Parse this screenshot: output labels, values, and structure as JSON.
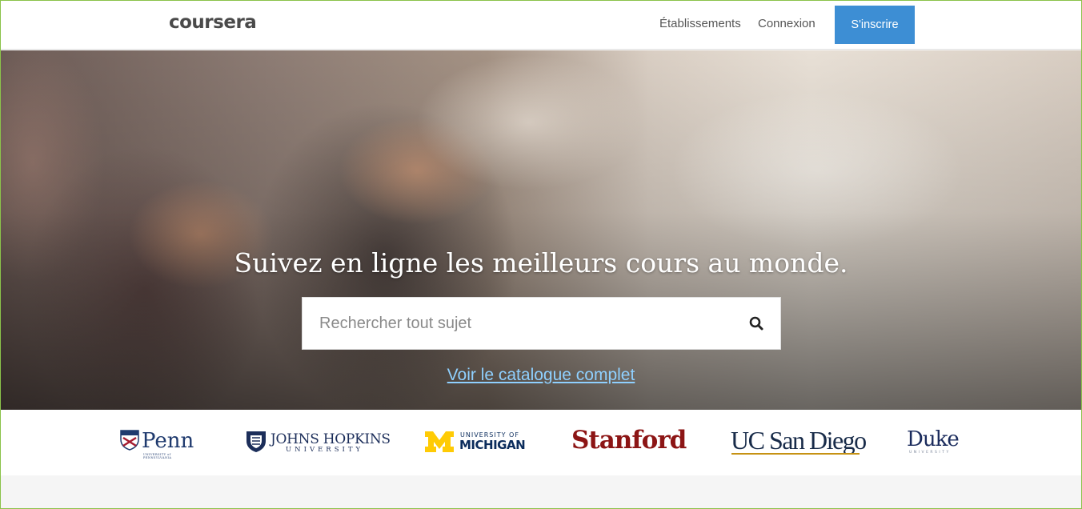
{
  "header": {
    "logo": "coursera",
    "nav": {
      "etablissements": "Établissements",
      "connexion": "Connexion"
    },
    "signup_label": "S'inscrire"
  },
  "hero": {
    "title": "Suivez en ligne les meilleurs cours au monde.",
    "search": {
      "placeholder": "Rechercher tout sujet",
      "value": ""
    },
    "search_icon": "search-icon",
    "catalog_link": "Voir le catalogue complet"
  },
  "partners": {
    "penn": {
      "name": "Penn",
      "sub": "UNIVERSITY of PENNSYLVANIA"
    },
    "jhu": {
      "name": "JOHNS HOPKINS",
      "sub": "UNIVERSITY"
    },
    "umich": {
      "sub": "UNIVERSITY OF",
      "name": "MICHIGAN"
    },
    "stanford": {
      "name": "Stanford"
    },
    "ucsd": {
      "name": "UC San Diego"
    },
    "duke": {
      "name": "Duke",
      "sub": "UNIVERSITY"
    }
  },
  "colors": {
    "signup_button": "#3d8ed4",
    "catalog_link": "#8fd0ff",
    "stanford": "#8c1515",
    "umich_maize": "#ffcb05",
    "ucsd_gold": "#c69214"
  }
}
